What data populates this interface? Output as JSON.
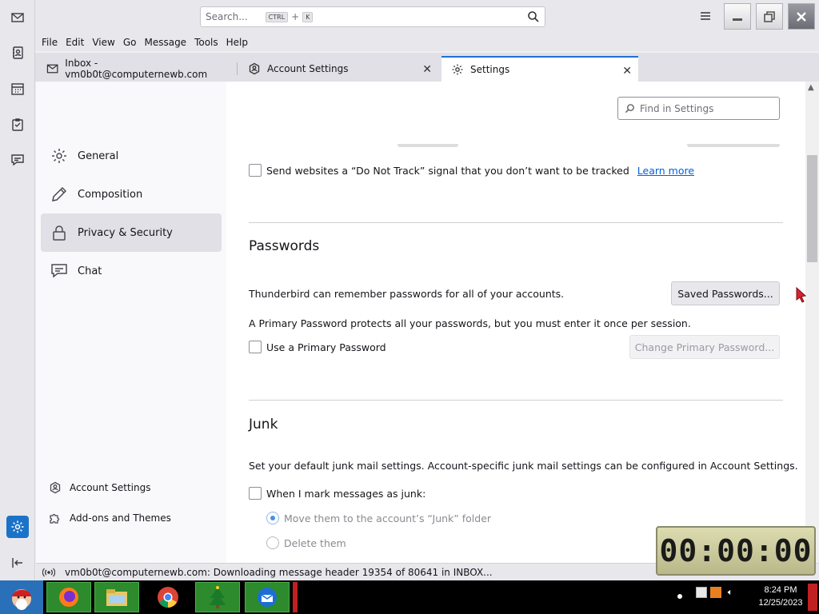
{
  "topbar": {
    "search_placeholder": "Search...",
    "search_kbd1": "CTRL",
    "search_plus": "+",
    "search_kbd2": "K"
  },
  "menu": [
    "File",
    "Edit",
    "View",
    "Go",
    "Message",
    "Tools",
    "Help"
  ],
  "tabs": [
    {
      "label": "Inbox - vm0b0t@computernewb.com"
    },
    {
      "label": "Account Settings"
    },
    {
      "label": "Settings"
    }
  ],
  "sidebar": {
    "items": [
      {
        "label": "General"
      },
      {
        "label": "Composition"
      },
      {
        "label": "Privacy & Security"
      },
      {
        "label": "Chat"
      }
    ],
    "footer": [
      {
        "label": "Account Settings"
      },
      {
        "label": "Add-ons and Themes"
      }
    ]
  },
  "main": {
    "find_placeholder": "Find in Settings",
    "dnt_label": "Send websites a “Do Not Track” signal that you don’t want to be tracked",
    "dnt_link": "Learn more",
    "passwords": {
      "heading": "Passwords",
      "remember_text": "Thunderbird can remember passwords for all of your accounts.",
      "saved_button": "Saved Passwords...",
      "primary_text": "A Primary Password protects all your passwords, but you must enter it once per session.",
      "use_primary": "Use a Primary Password",
      "change_primary": "Change Primary Password..."
    },
    "junk": {
      "heading": "Junk",
      "desc": "Set your default junk mail settings. Account-specific junk mail settings can be configured in Account Settings.",
      "when_mark": "When I mark messages as junk:",
      "move_option": "Move them to the account’s “Junk” folder",
      "delete_option": "Delete them"
    }
  },
  "status": {
    "text": "vm0b0t@computernewb.com: Downloading message header 19354 of 80641 in INBOX..."
  },
  "timer": {
    "display": "00:00:00"
  },
  "taskbar": {
    "time": "8:24 PM",
    "date": "12/25/2023"
  },
  "colors": {
    "accent": "#1f6fd1",
    "link": "#0061e0",
    "taskbar_app": "#2d8a2d"
  }
}
